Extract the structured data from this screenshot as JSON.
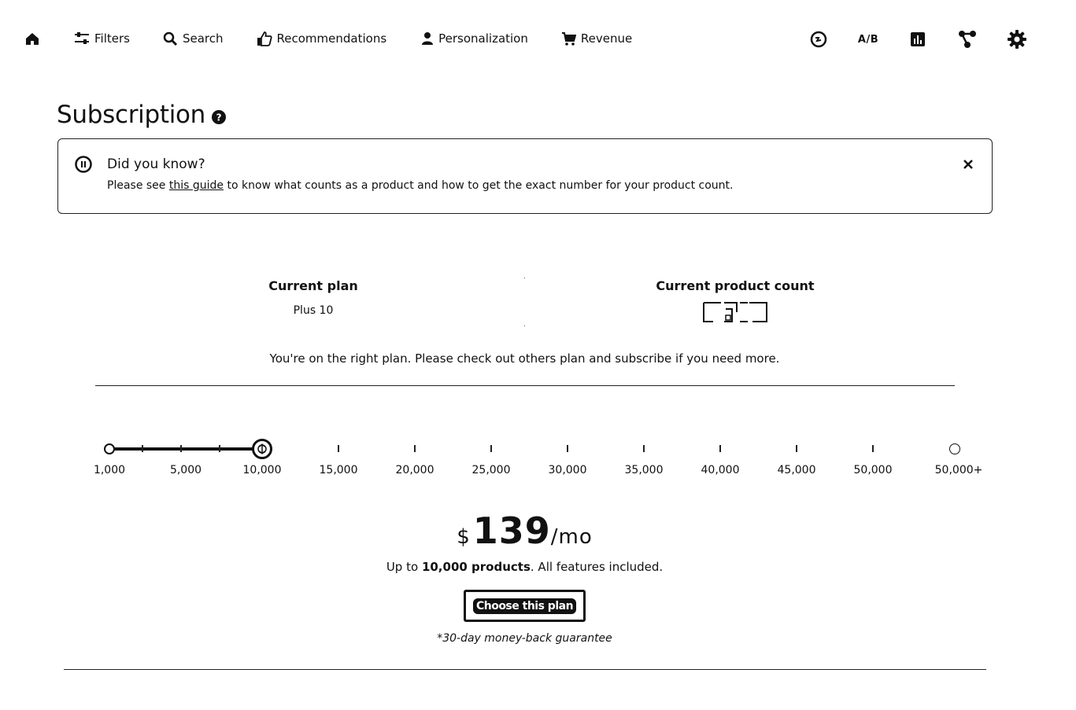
{
  "nav": {
    "items": [
      {
        "label": "Filters",
        "icon": "sliders-icon"
      },
      {
        "label": "Search",
        "icon": "search-icon"
      },
      {
        "label": "Recommendations",
        "icon": "thumbs-up-icon"
      },
      {
        "label": "Personalization",
        "icon": "user-icon"
      },
      {
        "label": "Revenue",
        "icon": "cart-icon"
      }
    ],
    "ab_label": "A/B"
  },
  "page": {
    "title": "Subscription"
  },
  "banner": {
    "title": "Did you know?",
    "text_before": "Please see ",
    "link": "this guide",
    "text_after": " to know what counts as a product and how to get the exact number for your product count."
  },
  "current": {
    "plan_label": "Current plan",
    "plan_value": "Plus 10",
    "count_label": "Current product count",
    "message": "You're on the right plan. Please check out others plan and subscribe if you need more."
  },
  "slider": {
    "labels": [
      "1,000",
      "5,000",
      "10,000",
      "15,000",
      "20,000",
      "25,000",
      "30,000",
      "35,000",
      "40,000",
      "45,000",
      "50,000",
      "50,000+"
    ],
    "selected_index": 2
  },
  "pricing": {
    "currency": "$",
    "amount": "139",
    "period": "/mo",
    "sub_before": "Up to ",
    "sub_bold": "10,000 products",
    "sub_after": ". All features included.",
    "button": "Choose this plan",
    "guarantee": "*30-day money-back guarantee"
  }
}
